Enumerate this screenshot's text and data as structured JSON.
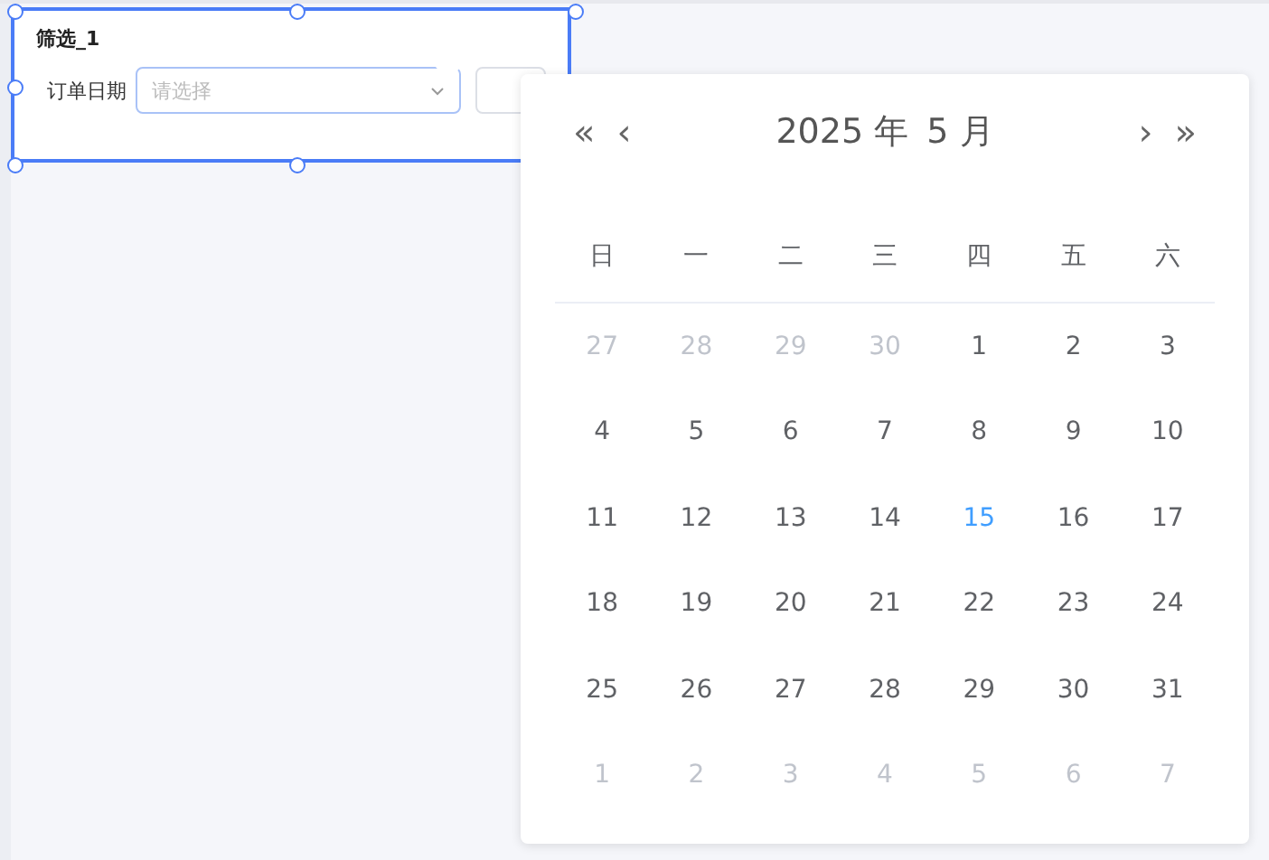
{
  "filter_card": {
    "title": "筛选_1",
    "label": "订单日期",
    "select": {
      "placeholder": "请选择"
    }
  },
  "calendar": {
    "year_label": "2025 年",
    "month_label": "5 月",
    "prev_year": "«",
    "prev_month": "‹",
    "next_month": "›",
    "next_year": "»",
    "weekdays": [
      "日",
      "一",
      "二",
      "三",
      "四",
      "五",
      "六"
    ],
    "weeks": [
      [
        {
          "day": "27",
          "kind": "other"
        },
        {
          "day": "28",
          "kind": "other"
        },
        {
          "day": "29",
          "kind": "other"
        },
        {
          "day": "30",
          "kind": "other"
        },
        {
          "day": "1",
          "kind": "current"
        },
        {
          "day": "2",
          "kind": "current"
        },
        {
          "day": "3",
          "kind": "current"
        }
      ],
      [
        {
          "day": "4",
          "kind": "current"
        },
        {
          "day": "5",
          "kind": "current"
        },
        {
          "day": "6",
          "kind": "current"
        },
        {
          "day": "7",
          "kind": "current"
        },
        {
          "day": "8",
          "kind": "current"
        },
        {
          "day": "9",
          "kind": "current"
        },
        {
          "day": "10",
          "kind": "current"
        }
      ],
      [
        {
          "day": "11",
          "kind": "current"
        },
        {
          "day": "12",
          "kind": "current"
        },
        {
          "day": "13",
          "kind": "current"
        },
        {
          "day": "14",
          "kind": "current"
        },
        {
          "day": "15",
          "kind": "today"
        },
        {
          "day": "16",
          "kind": "current"
        },
        {
          "day": "17",
          "kind": "current"
        }
      ],
      [
        {
          "day": "18",
          "kind": "current"
        },
        {
          "day": "19",
          "kind": "current"
        },
        {
          "day": "20",
          "kind": "current"
        },
        {
          "day": "21",
          "kind": "current"
        },
        {
          "day": "22",
          "kind": "current"
        },
        {
          "day": "23",
          "kind": "current"
        },
        {
          "day": "24",
          "kind": "current"
        }
      ],
      [
        {
          "day": "25",
          "kind": "current"
        },
        {
          "day": "26",
          "kind": "current"
        },
        {
          "day": "27",
          "kind": "current"
        },
        {
          "day": "28",
          "kind": "current"
        },
        {
          "day": "29",
          "kind": "current"
        },
        {
          "day": "30",
          "kind": "current"
        },
        {
          "day": "31",
          "kind": "current"
        }
      ],
      [
        {
          "day": "1",
          "kind": "other"
        },
        {
          "day": "2",
          "kind": "other"
        },
        {
          "day": "3",
          "kind": "other"
        },
        {
          "day": "4",
          "kind": "other"
        },
        {
          "day": "5",
          "kind": "other"
        },
        {
          "day": "6",
          "kind": "other"
        },
        {
          "day": "7",
          "kind": "other"
        }
      ]
    ]
  }
}
